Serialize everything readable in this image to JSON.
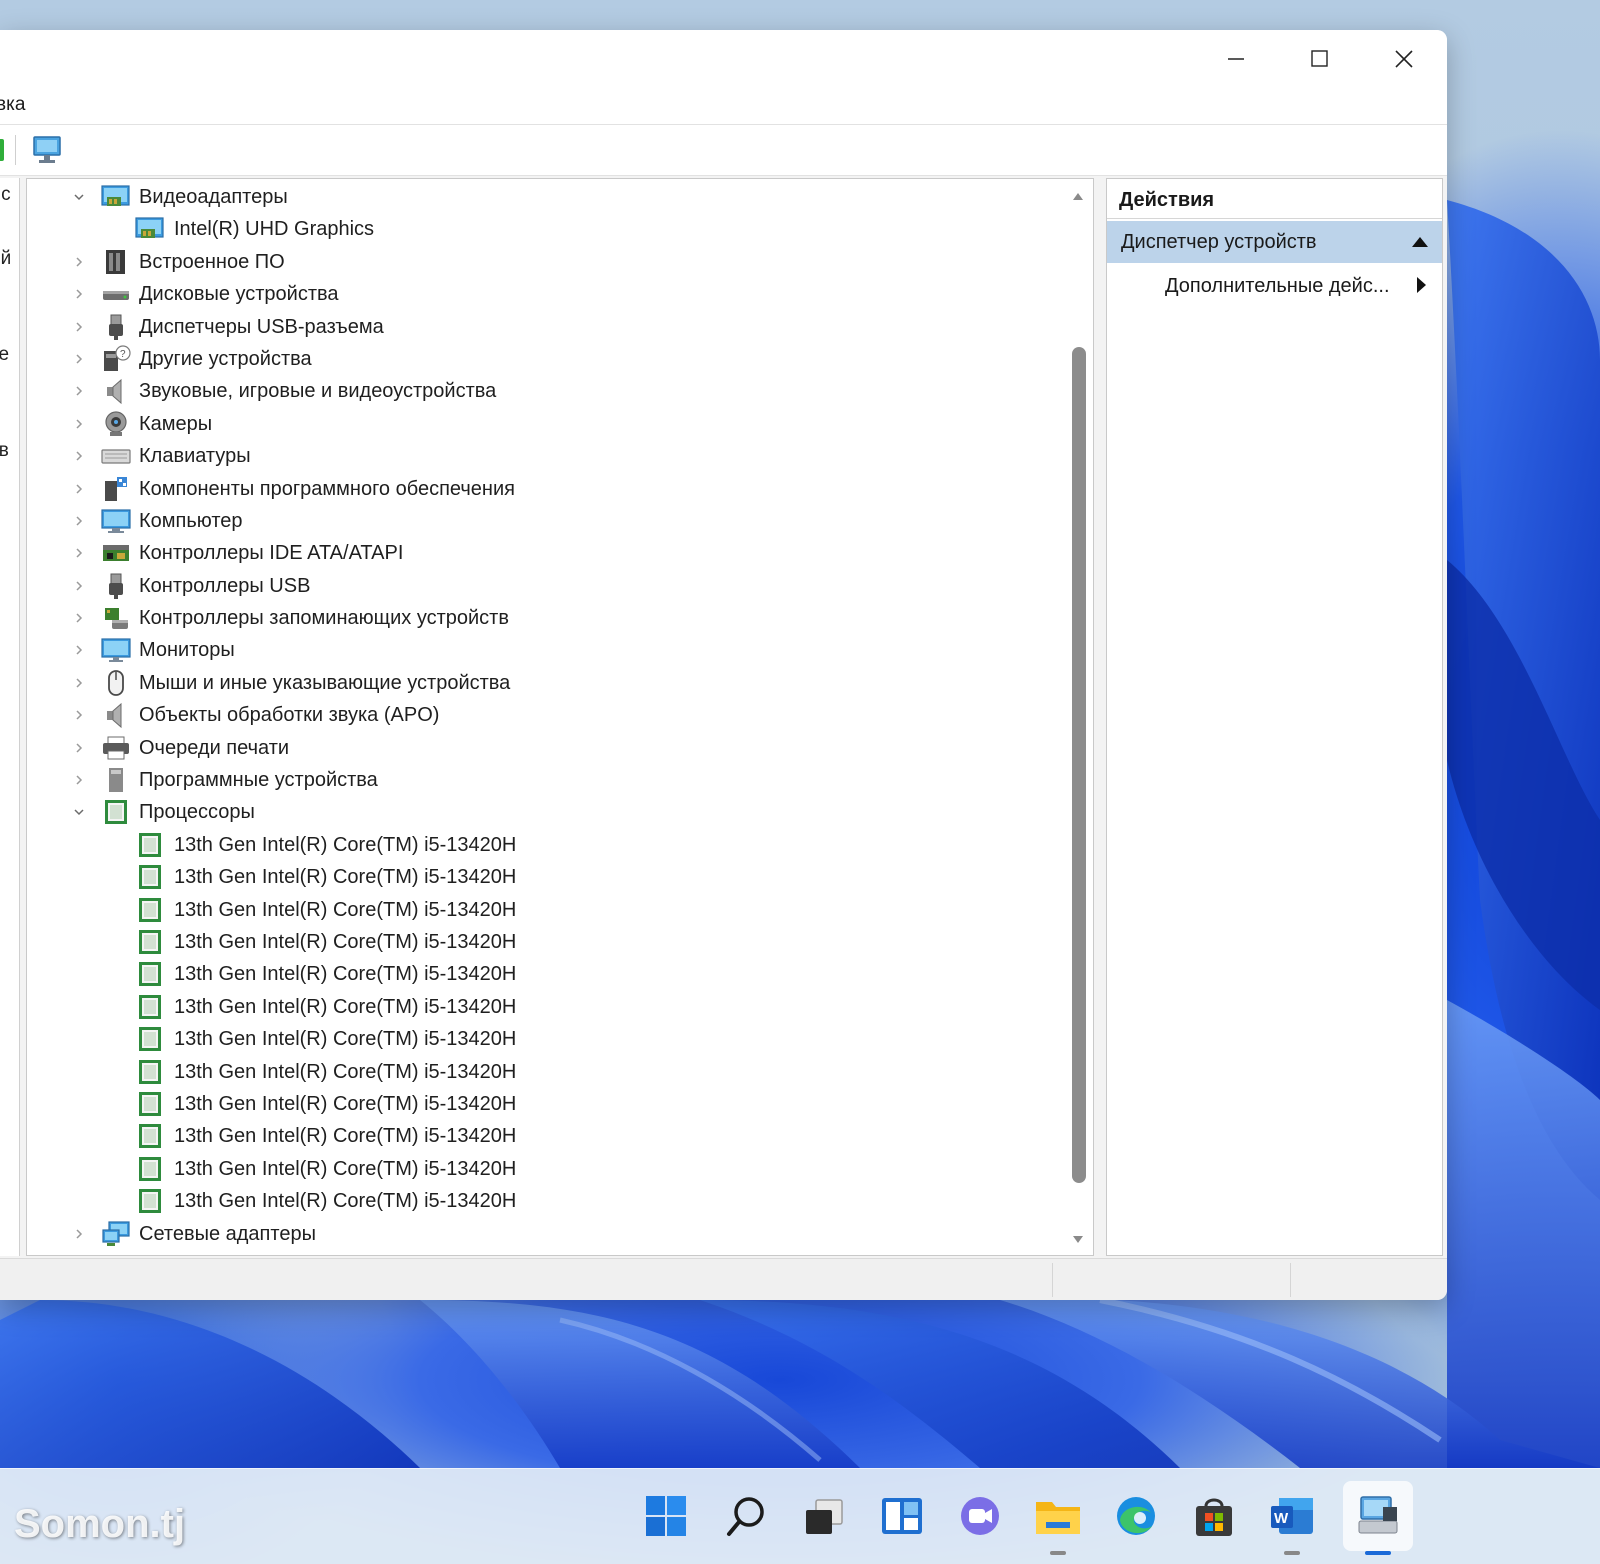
{
  "window": {
    "menu_fragment": "вка",
    "left_pane_fragments": [
      "лс",
      "ий",
      "те",
      "тв"
    ]
  },
  "tree": [
    {
      "label": "Видеоадаптеры",
      "level": 0,
      "expanded": true,
      "icon": "display-adapter-icon"
    },
    {
      "label": "Intel(R) UHD Graphics",
      "level": 1,
      "icon": "display-adapter-icon"
    },
    {
      "label": "Встроенное ПО",
      "level": 0,
      "expanded": false,
      "icon": "firmware-icon"
    },
    {
      "label": "Дисковые устройства",
      "level": 0,
      "expanded": false,
      "icon": "disk-drive-icon"
    },
    {
      "label": "Диспетчеры USB-разъема",
      "level": 0,
      "expanded": false,
      "icon": "usb-connector-icon"
    },
    {
      "label": "Другие устройства",
      "level": 0,
      "expanded": false,
      "icon": "other-devices-icon"
    },
    {
      "label": "Звуковые, игровые и видеоустройства",
      "level": 0,
      "expanded": false,
      "icon": "speaker-icon"
    },
    {
      "label": "Камеры",
      "level": 0,
      "expanded": false,
      "icon": "camera-icon"
    },
    {
      "label": "Клавиатуры",
      "level": 0,
      "expanded": false,
      "icon": "keyboard-icon"
    },
    {
      "label": "Компоненты программного обеспечения",
      "level": 0,
      "expanded": false,
      "icon": "software-component-icon"
    },
    {
      "label": "Компьютер",
      "level": 0,
      "expanded": false,
      "icon": "computer-icon"
    },
    {
      "label": "Контроллеры IDE ATA/ATAPI",
      "level": 0,
      "expanded": false,
      "icon": "ide-controller-icon"
    },
    {
      "label": "Контроллеры USB",
      "level": 0,
      "expanded": false,
      "icon": "usb-connector-icon"
    },
    {
      "label": "Контроллеры запоминающих устройств",
      "level": 0,
      "expanded": false,
      "icon": "storage-controller-icon"
    },
    {
      "label": "Мониторы",
      "level": 0,
      "expanded": false,
      "icon": "monitor-icon"
    },
    {
      "label": "Мыши и иные указывающие устройства",
      "level": 0,
      "expanded": false,
      "icon": "mouse-icon"
    },
    {
      "label": "Объекты обработки звука (APO)",
      "level": 0,
      "expanded": false,
      "icon": "speaker-icon"
    },
    {
      "label": "Очереди печати",
      "level": 0,
      "expanded": false,
      "icon": "printer-icon"
    },
    {
      "label": "Программные устройства",
      "level": 0,
      "expanded": false,
      "icon": "software-device-icon"
    },
    {
      "label": "Процессоры",
      "level": 0,
      "expanded": true,
      "icon": "processor-icon"
    },
    {
      "label": "13th Gen Intel(R) Core(TM) i5-13420H",
      "level": 1,
      "icon": "processor-icon"
    },
    {
      "label": "13th Gen Intel(R) Core(TM) i5-13420H",
      "level": 1,
      "icon": "processor-icon"
    },
    {
      "label": "13th Gen Intel(R) Core(TM) i5-13420H",
      "level": 1,
      "icon": "processor-icon"
    },
    {
      "label": "13th Gen Intel(R) Core(TM) i5-13420H",
      "level": 1,
      "icon": "processor-icon"
    },
    {
      "label": "13th Gen Intel(R) Core(TM) i5-13420H",
      "level": 1,
      "icon": "processor-icon"
    },
    {
      "label": "13th Gen Intel(R) Core(TM) i5-13420H",
      "level": 1,
      "icon": "processor-icon"
    },
    {
      "label": "13th Gen Intel(R) Core(TM) i5-13420H",
      "level": 1,
      "icon": "processor-icon"
    },
    {
      "label": "13th Gen Intel(R) Core(TM) i5-13420H",
      "level": 1,
      "icon": "processor-icon"
    },
    {
      "label": "13th Gen Intel(R) Core(TM) i5-13420H",
      "level": 1,
      "icon": "processor-icon"
    },
    {
      "label": "13th Gen Intel(R) Core(TM) i5-13420H",
      "level": 1,
      "icon": "processor-icon"
    },
    {
      "label": "13th Gen Intel(R) Core(TM) i5-13420H",
      "level": 1,
      "icon": "processor-icon"
    },
    {
      "label": "13th Gen Intel(R) Core(TM) i5-13420H",
      "level": 1,
      "icon": "processor-icon"
    },
    {
      "label": "Сетевые адаптеры",
      "level": 0,
      "expanded": false,
      "icon": "network-adapter-icon"
    }
  ],
  "actions": {
    "title": "Действия",
    "section": "Диспетчер устройств",
    "item": "Дополнительные дейс..."
  },
  "taskbar": {
    "items": [
      "start-icon",
      "search-icon",
      "task-view-icon",
      "widgets-icon",
      "chat-icon",
      "file-explorer-icon",
      "edge-icon",
      "store-icon",
      "word-icon",
      "device-manager-icon"
    ],
    "active": "device-manager-icon"
  },
  "watermark": "Somon.tj",
  "colors": {
    "selection": "#bcd3ea",
    "accent": "#1a6ad8",
    "processor_green": "#2e8b3d"
  }
}
